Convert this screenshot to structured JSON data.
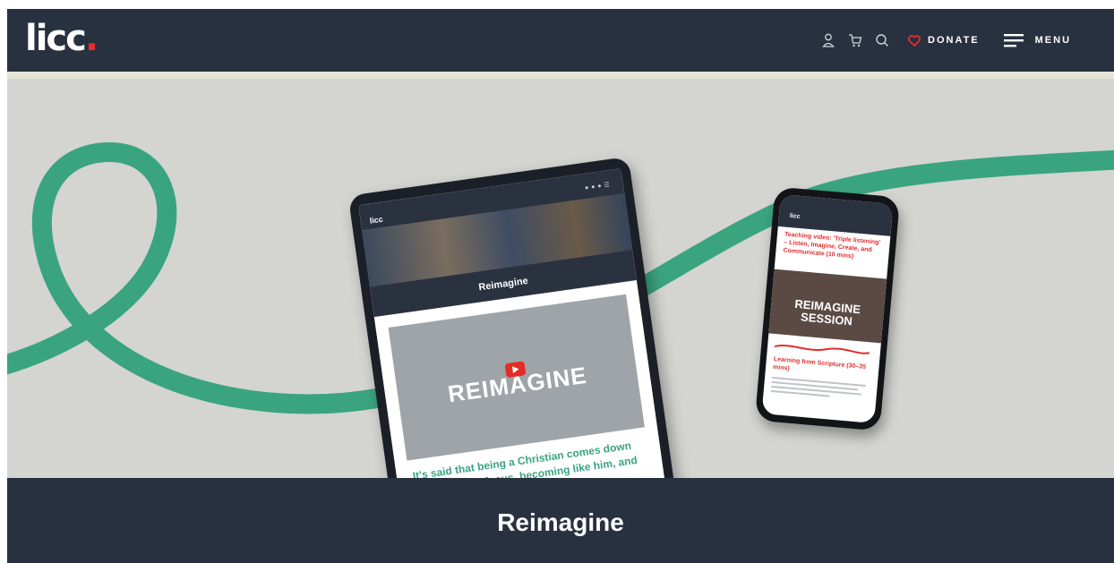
{
  "header": {
    "logo_text": "licc",
    "logo_dot": ".",
    "donate_label": "DONATE",
    "menu_label": "MENU",
    "icons": [
      "user-icon",
      "cart-icon",
      "search-icon",
      "heart-icon",
      "hamburger-icon"
    ]
  },
  "hero": {
    "tablet": {
      "logo": "licc",
      "title": "Reimagine",
      "video_word": "REIMAGINE",
      "quote": "It's said that being a Christian comes down to being with Jesus, becoming like him, and"
    },
    "phone": {
      "logo": "licc",
      "heading": "Teaching video: 'Triple listening' – Listen, Imagine, Create, and Communicate (10 mins)",
      "video_word": "REIMAGINE SESSION",
      "subheading": "Learning from Scripture (30–35 mins)"
    }
  },
  "page": {
    "title": "Reimagine"
  },
  "colors": {
    "header_bg": "#283140",
    "accent_red": "#e32d2d",
    "ribbon_green": "#3aa481",
    "hero_bg": "#d4d4d0"
  }
}
